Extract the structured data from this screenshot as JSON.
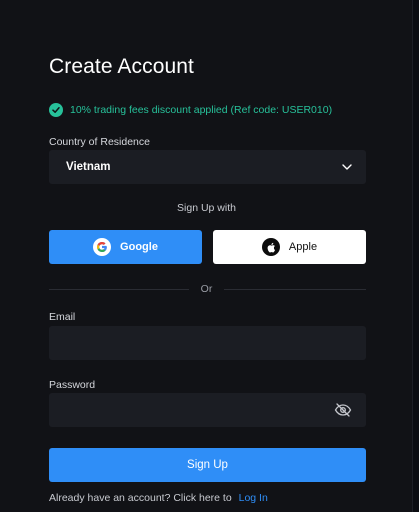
{
  "colors": {
    "background": "#111216",
    "field": "#1b1d23",
    "accent": "#2f8ef7",
    "success": "#27c19a"
  },
  "header": {
    "title": "Create Account"
  },
  "promo": {
    "text": "10% trading fees discount applied (Ref code: USER010)",
    "icon": "check-circle-icon"
  },
  "country": {
    "label": "Country of Residence",
    "value": "Vietnam",
    "icon": "chevron-down-icon"
  },
  "social": {
    "heading": "Sign Up with",
    "google_label": "Google",
    "apple_label": "Apple"
  },
  "divider": {
    "text": "Or"
  },
  "email": {
    "label": "Email",
    "value": "",
    "placeholder": ""
  },
  "password": {
    "label": "Password",
    "value": "",
    "placeholder": "",
    "icon": "eye-off-icon"
  },
  "submit": {
    "label": "Sign Up"
  },
  "footer": {
    "text": "Already have an account? Click here to",
    "link": "Log In"
  }
}
